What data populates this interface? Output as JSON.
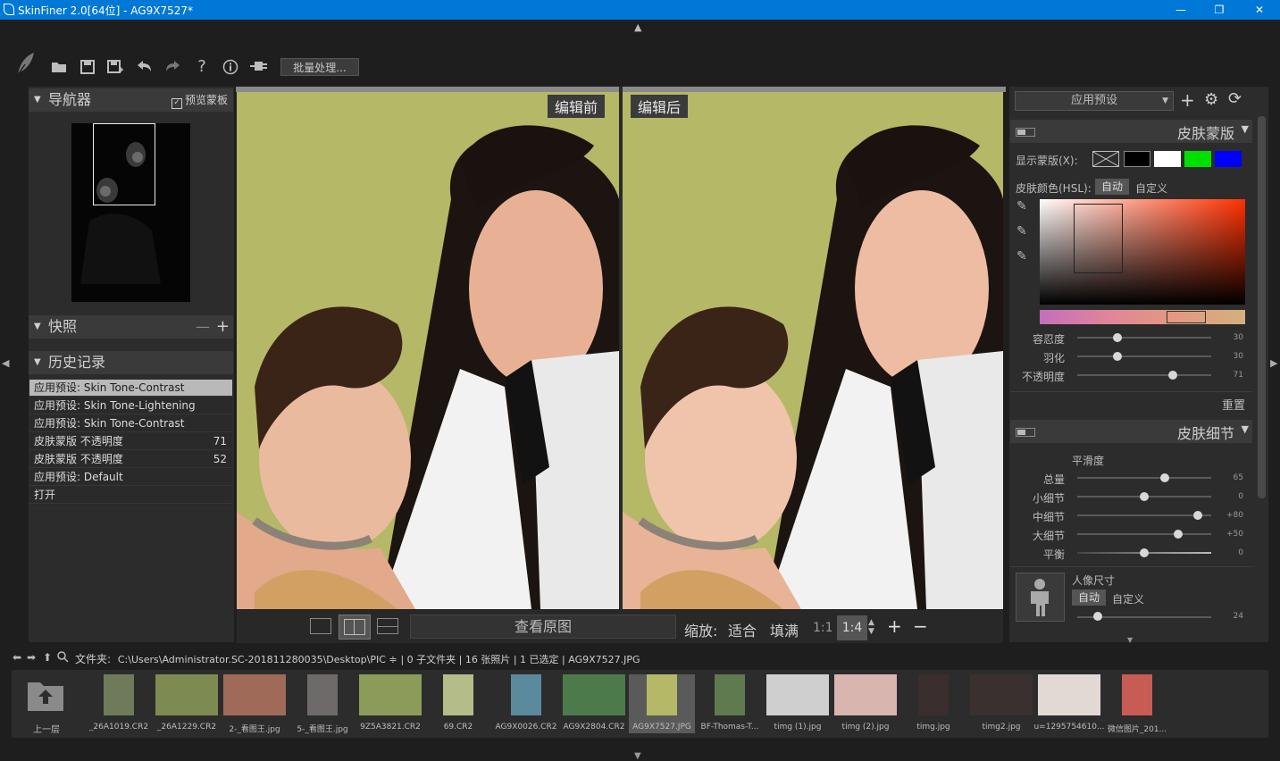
{
  "window": {
    "title": "SkinFiner 2.0[64位] - AG9X7527*",
    "minimize": "—",
    "maximize": "❐",
    "close": "✕"
  },
  "toolbar": {
    "batch_label": "批量处理..."
  },
  "navigator": {
    "title": "导航器",
    "preview_mask_label": "预览蒙板",
    "preview_mask_checked": true
  },
  "snapshots": {
    "title": "快照"
  },
  "history": {
    "title": "历史记录",
    "items": [
      {
        "label": "应用预设: Skin Tone-Contrast",
        "value": "",
        "selected": true
      },
      {
        "label": "应用预设: Skin Tone-Lightening",
        "value": "",
        "selected": false
      },
      {
        "label": "应用预设: Skin Tone-Contrast",
        "value": "",
        "selected": false
      },
      {
        "label": "皮肤蒙版 不透明度",
        "value": "71",
        "selected": false
      },
      {
        "label": "皮肤蒙版 不透明度",
        "value": "52",
        "selected": false
      },
      {
        "label": "应用预设: Default",
        "value": "",
        "selected": false
      },
      {
        "label": "打开",
        "value": "",
        "selected": false
      }
    ]
  },
  "viewer": {
    "before_label": "编辑前",
    "after_label": "编辑后",
    "view_original": "查看原图",
    "zoom_label": "缩放:",
    "fit": "适合",
    "fill": "填满",
    "one_to_one": "1:1",
    "zoom_value": "1:4",
    "background_color": "#b5b867"
  },
  "presets": {
    "selected": "应用预设"
  },
  "skin_mask": {
    "title": "皮肤蒙版",
    "show_mask_label": "显示蒙版(X):",
    "mask_colors": [
      "#000000",
      "#ffffff",
      "#00e000",
      "#0000ff"
    ],
    "skin_color_label": "皮肤颜色(HSL):",
    "auto": "自动",
    "custom": "自定义",
    "sliders": [
      {
        "label": "容忍度",
        "value": "30",
        "fraction": 0.3
      },
      {
        "label": "羽化",
        "value": "30",
        "fraction": 0.3
      },
      {
        "label": "不透明度",
        "value": "71",
        "fraction": 0.71
      }
    ],
    "reset": "重置"
  },
  "skin_detail": {
    "title": "皮肤细节",
    "smoothness_label": "平滑度",
    "sliders": [
      {
        "label": "总量",
        "value": "65",
        "fraction": 0.65
      },
      {
        "label": "小细节",
        "value": "0",
        "fraction": 0.5
      },
      {
        "label": "中细节",
        "value": "+80",
        "fraction": 0.9
      },
      {
        "label": "大细节",
        "value": "+50",
        "fraction": 0.75
      },
      {
        "label": "平衡",
        "value": "0",
        "fraction": 0.5
      }
    ],
    "portrait_size_label": "人像尺寸",
    "auto": "自动",
    "custom": "自定义",
    "portrait_value": "24",
    "portrait_fraction": 0.15
  },
  "pathbar": {
    "folder_label": "文件夹:",
    "path": "C:\\Users\\Administrator.SC-201811280035\\Desktop\\PIC ≑",
    "info": "| 0 子文件夹 | 16 张照片 | 1 已选定 | AG9X7527.JPG"
  },
  "filmstrip": {
    "up_label": "上一层",
    "items": [
      {
        "name": "_26A1019.CR2",
        "color": "#6f7a5a",
        "selected": false
      },
      {
        "name": "_26A1229.CR2",
        "color": "#7d8a52",
        "selected": false
      },
      {
        "name": "2-_看图王.jpg",
        "color": "#a06a58",
        "selected": false
      },
      {
        "name": "5-_看图王.jpg",
        "color": "#6e6a6a",
        "selected": false
      },
      {
        "name": "9Z5A3821.CR2",
        "color": "#8c9a5a",
        "selected": false
      },
      {
        "name": "69.CR2",
        "color": "#b4bc8a",
        "selected": false
      },
      {
        "name": "AG9X0026.CR2",
        "color": "#5b8a9c",
        "selected": false
      },
      {
        "name": "AG9X2804.CR2",
        "color": "#4d7a4a",
        "selected": false
      },
      {
        "name": "AG9X7527.JPG",
        "color": "#b5b867",
        "selected": true
      },
      {
        "name": "BF-Thomas-T...",
        "color": "#5e7a4e",
        "selected": false
      },
      {
        "name": "timg (1).jpg",
        "color": "#cfcfcf",
        "selected": false
      },
      {
        "name": "timg (2).jpg",
        "color": "#d9b5b0",
        "selected": false
      },
      {
        "name": "timg.jpg",
        "color": "#3a2e2e",
        "selected": false
      },
      {
        "name": "timg2.jpg",
        "color": "#3b3030",
        "selected": false
      },
      {
        "name": "u=1295754610...",
        "color": "#e2d9d4",
        "selected": false
      },
      {
        "name": "微信图片_201...",
        "color": "#c75c55",
        "selected": false
      }
    ]
  }
}
